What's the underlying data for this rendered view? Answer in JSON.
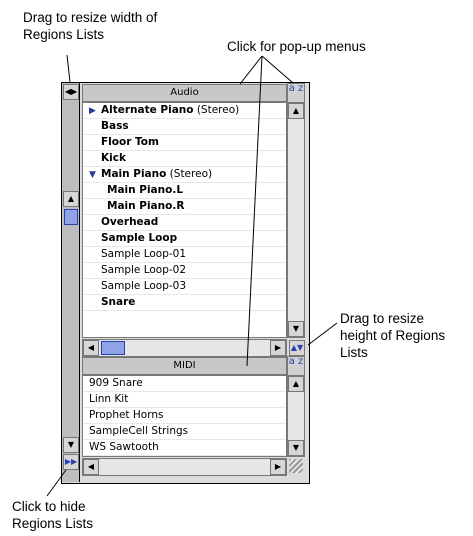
{
  "callouts": {
    "resize_width": [
      "Drag to resize width of",
      "Regions Lists"
    ],
    "popup_menus": "Click for pop-up menus",
    "resize_height": [
      "Drag to resize",
      "height of Regions",
      "Lists"
    ],
    "hide_lists": [
      "Click to hide",
      "Regions Lists"
    ]
  },
  "audio_list": {
    "title": "Audio",
    "sort_icon": "a-z-sort-icon",
    "items": [
      {
        "name": "Alternate Piano",
        "suffix": " (Stereo)",
        "bold": true,
        "marker": "▶",
        "indent": false
      },
      {
        "name": "Bass",
        "suffix": "",
        "bold": true,
        "marker": "",
        "indent": false
      },
      {
        "name": "Floor Tom",
        "suffix": "",
        "bold": true,
        "marker": "",
        "indent": false
      },
      {
        "name": "Kick",
        "suffix": "",
        "bold": true,
        "marker": "",
        "indent": false
      },
      {
        "name": "Main Piano",
        "suffix": " (Stereo)",
        "bold": true,
        "marker": "▼",
        "indent": false
      },
      {
        "name": "Main Piano.L",
        "suffix": "",
        "bold": true,
        "marker": "",
        "indent": true
      },
      {
        "name": "Main Piano.R",
        "suffix": "",
        "bold": true,
        "marker": "",
        "indent": true
      },
      {
        "name": "Overhead",
        "suffix": "",
        "bold": true,
        "marker": "",
        "indent": false
      },
      {
        "name": "Sample Loop",
        "suffix": "",
        "bold": true,
        "marker": "",
        "indent": false
      },
      {
        "name": "Sample Loop-01",
        "suffix": "",
        "bold": false,
        "marker": "",
        "indent": false
      },
      {
        "name": "Sample Loop-02",
        "suffix": "",
        "bold": false,
        "marker": "",
        "indent": false
      },
      {
        "name": "Sample Loop-03",
        "suffix": "",
        "bold": false,
        "marker": "",
        "indent": false
      },
      {
        "name": "Snare",
        "suffix": "",
        "bold": true,
        "marker": "",
        "indent": false
      }
    ]
  },
  "midi_list": {
    "title": "MIDI",
    "sort_icon": "a-z-sort-icon",
    "items": [
      "909 Snare",
      "Linn Kit",
      "Prophet Horns",
      "SampleCell Strings",
      "WS Sawtooth"
    ]
  },
  "sort_label": "a z"
}
